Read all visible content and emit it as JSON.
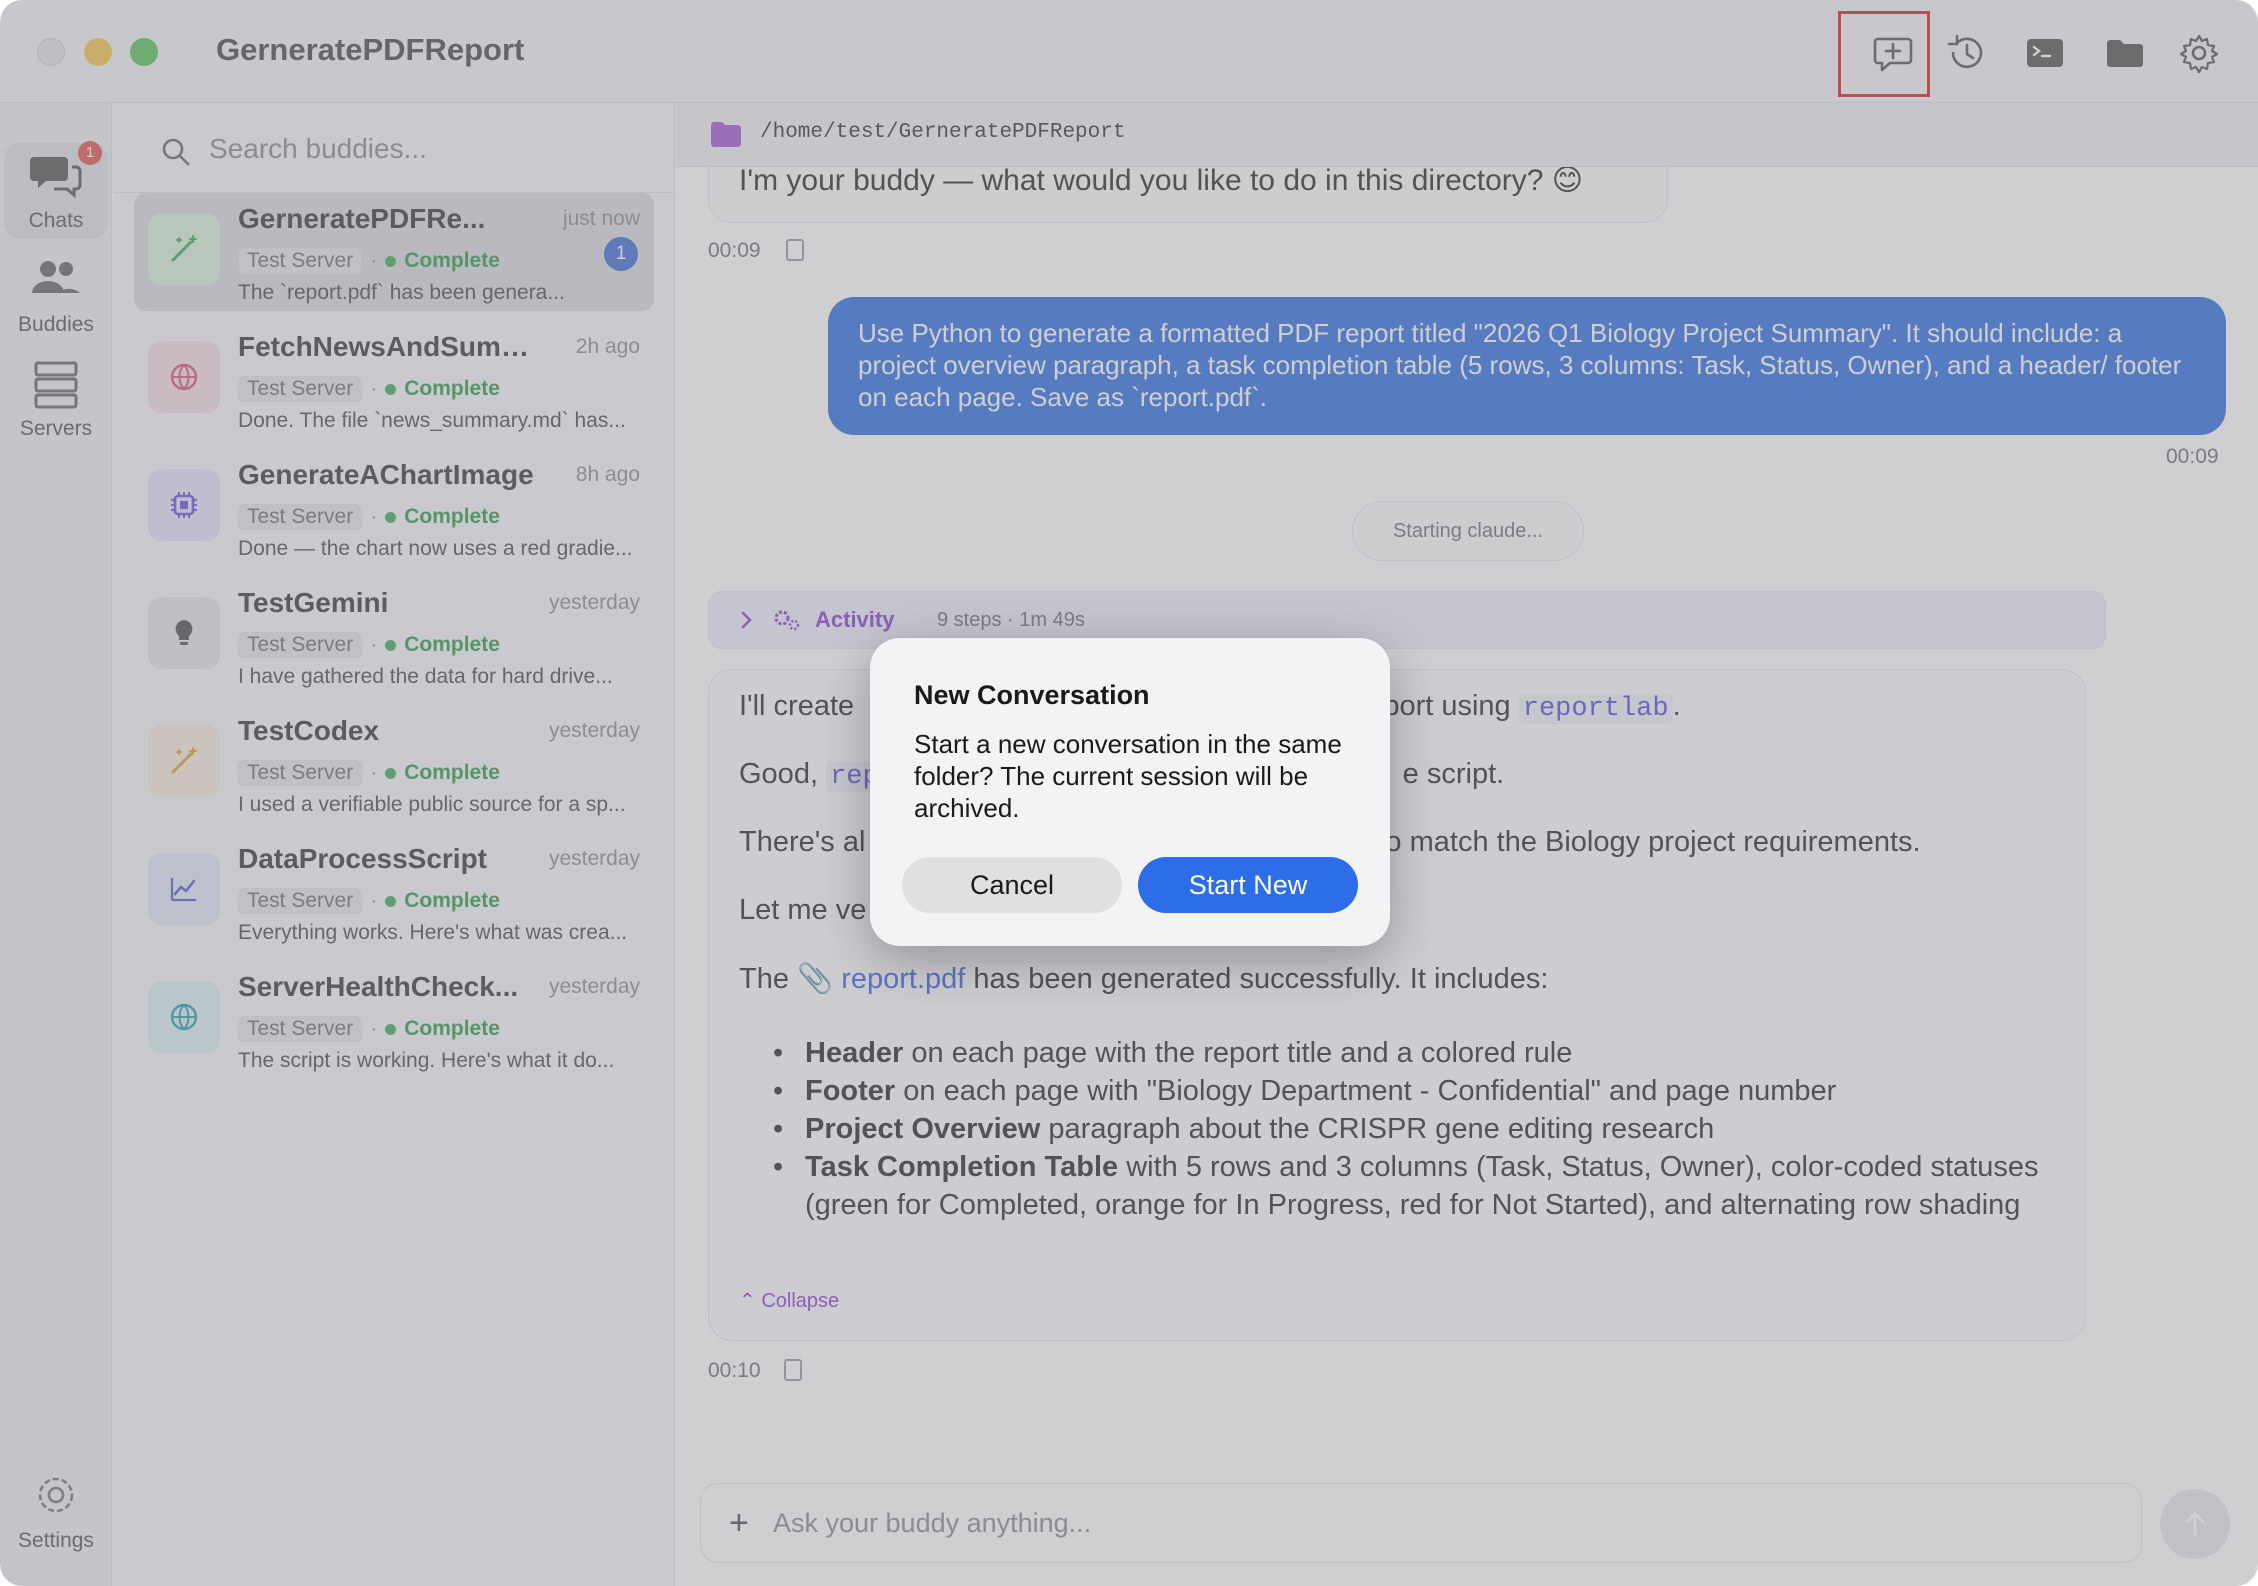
{
  "window": {
    "title": "GerneratePDFReport"
  },
  "toolbar": {
    "icons": [
      "new-conversation-icon",
      "history-icon",
      "terminal-icon",
      "folder-icon",
      "gear-icon"
    ]
  },
  "rail": {
    "chats_label": "Chats",
    "chats_badge": "1",
    "buddies_label": "Buddies",
    "servers_label": "Servers",
    "settings_label": "Settings"
  },
  "search": {
    "placeholder": "Search buddies..."
  },
  "chats": [
    {
      "name": "GerneratePDFRe...",
      "time": "just now",
      "server": "Test Server",
      "status": "Complete",
      "preview": "The `report.pdf` has been genera...",
      "unread": "1",
      "avatar_color": "#d9efd9",
      "icon": "wand-icon"
    },
    {
      "name": "FetchNewsAndSumma...",
      "time": "2h ago",
      "server": "Test Server",
      "status": "Complete",
      "preview": "Done. The file `news_summary.md` has...",
      "avatar_color": "#f7dde6",
      "icon": "globe-icon"
    },
    {
      "name": "GenerateAChartImage",
      "time": "8h ago",
      "server": "Test Server",
      "status": "Complete",
      "preview": "Done — the chart now uses a red gradie...",
      "avatar_color": "#e6e2f8",
      "icon": "chip-icon"
    },
    {
      "name": "TestGemini",
      "time": "yesterday",
      "server": "Test Server",
      "status": "Complete",
      "preview": "I have gathered the data for hard drive...",
      "avatar_color": "#e4e4e8",
      "icon": "bulb-icon"
    },
    {
      "name": "TestCodex",
      "time": "yesterday",
      "server": "Test Server",
      "status": "Complete",
      "preview": "I used a verifiable public source for a sp...",
      "avatar_color": "#f8ecd9",
      "icon": "wand-icon"
    },
    {
      "name": "DataProcessScript",
      "time": "yesterday",
      "server": "Test Server",
      "status": "Complete",
      "preview": "Everything works. Here's what was crea...",
      "avatar_color": "#e3e6f6",
      "icon": "chart-line-icon"
    },
    {
      "name": "ServerHealthCheck...",
      "time": "yesterday",
      "server": "Test Server",
      "status": "Complete",
      "preview": "The script is working. Here's what it do...",
      "avatar_color": "#dcf0f2",
      "icon": "globe-icon"
    }
  ],
  "main": {
    "path": "/home/test/GerneratePDFReport",
    "greeting": "I'm your buddy — what would you like to do in this directory? 😊",
    "greeting_time": "00:09",
    "user_message": "Use Python to generate a formatted PDF report titled \"2026 Q1 Biology Project Summary\". It should include: a project overview paragraph, a task completion table (5 rows, 3 columns: Task, Status, Owner), and a header/ footer on each page. Save as `report.pdf`.",
    "user_time": "00:09",
    "starting": "Starting claude...",
    "activity_label": "Activity",
    "activity_meta": "9 steps · 1m 49s",
    "a_line1_pre": "I'll create",
    "a_line1_post": "eport using",
    "a_line1_code": "reportlab",
    "a_line1_end": ".",
    "a_line2_pre": "Good,",
    "a_line2_code": "rep",
    "a_line2_post": "e script.",
    "a_line3_pre": "There's al",
    "a_line3_post": "o match the Biology project requirements.",
    "a_line4": "Let me ve",
    "a_line5_pre": "The",
    "a_line5_link": "report.pdf",
    "a_line5_post": "has been generated successfully. It includes:",
    "bullets": [
      {
        "bold": "Header",
        "text": " on each page with the report title and a colored rule"
      },
      {
        "bold": "Footer",
        "text": " on each page with \"Biology Department - Confidential\" and page number"
      },
      {
        "bold": "Project Overview",
        "text": " paragraph about the CRISPR gene editing research"
      },
      {
        "bold": "Task Completion Table",
        "text": " with 5 rows and 3 columns (Task, Status, Owner), color-coded statuses (green for Completed, orange for In Progress, red for Not Started), and alternating row shading"
      }
    ],
    "collapse_label": "Collapse",
    "assistant_time": "00:10",
    "composer_placeholder": "Ask your buddy anything..."
  },
  "dialog": {
    "title": "New Conversation",
    "body": "Start a new conversation in the same folder? The current session will be archived.",
    "cancel_label": "Cancel",
    "confirm_label": "Start New"
  },
  "colors": {
    "accent": "#2d6de8",
    "status_complete": "#3cae58",
    "highlight": "#e02020"
  }
}
